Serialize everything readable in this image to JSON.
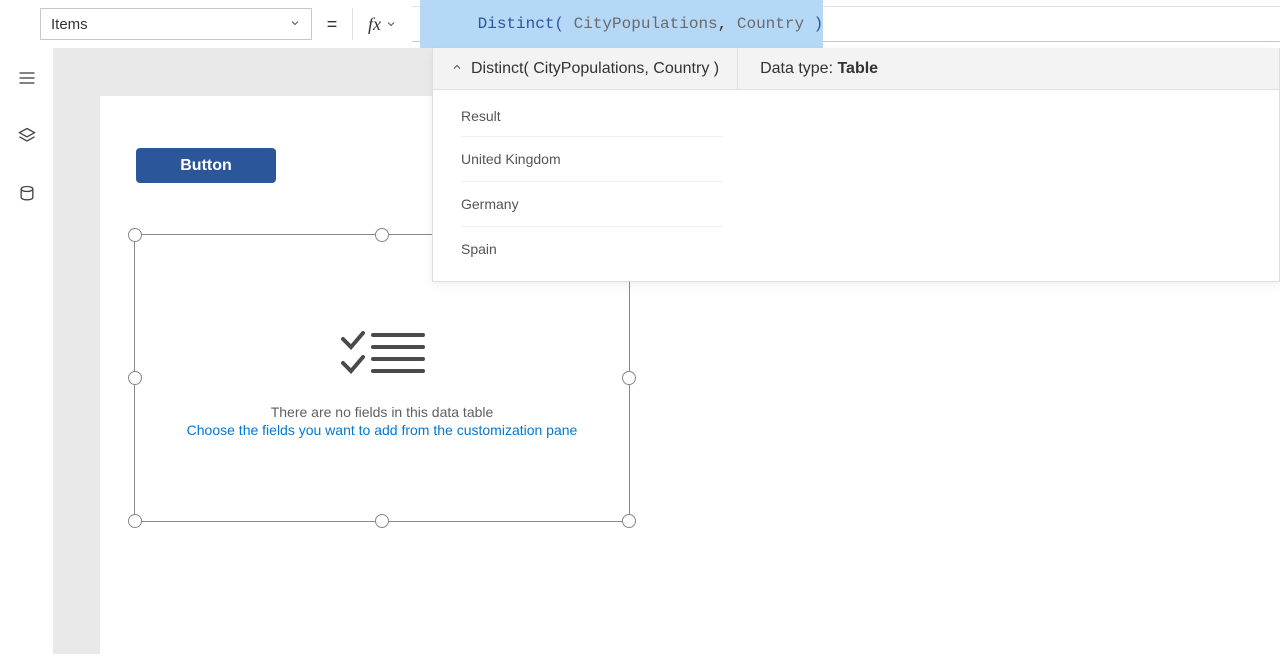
{
  "property_dropdown": {
    "value": "Items"
  },
  "equals": "=",
  "fx_label": "fx",
  "formula": {
    "func": "Distinct",
    "open": "( ",
    "arg1": "CityPopulations",
    "comma": ", ",
    "arg2": "Country",
    "close": " )"
  },
  "result_panel": {
    "expression": "Distinct( CityPopulations, Country )",
    "datatype_label": "Data type: ",
    "datatype_value": "Table",
    "column_header": "Result",
    "rows": [
      "United Kingdom",
      "Germany",
      "Spain"
    ]
  },
  "canvas": {
    "button_label": "Button",
    "empty_line1": "There are no fields in this data table",
    "empty_line2": "Choose the fields you want to add from the customization pane"
  }
}
